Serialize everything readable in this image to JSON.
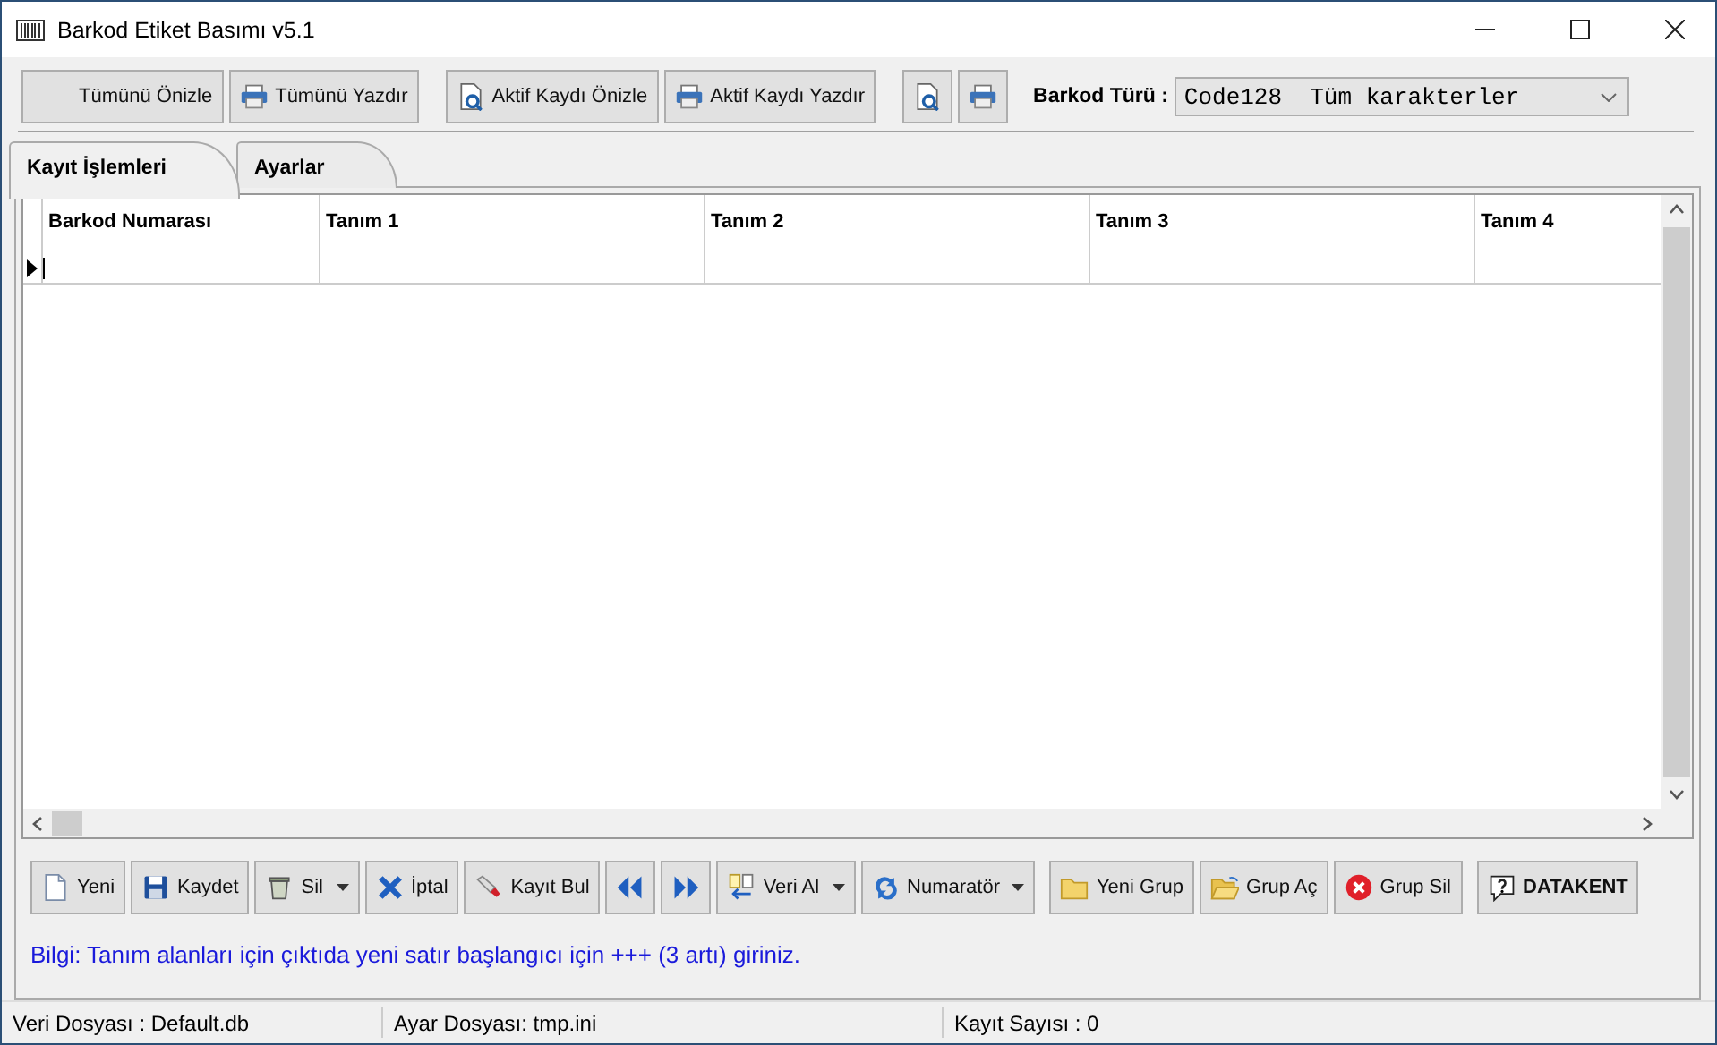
{
  "window": {
    "title": "Barkod Etiket Basımı  v5.1"
  },
  "toolbar": {
    "groups": [
      {
        "buttons": [
          {
            "label": "Tümünü Önizle",
            "kind": "none"
          },
          {
            "label": "Tümünü Yazdır",
            "kind": "print"
          }
        ]
      },
      {
        "buttons": [
          {
            "label": "Aktif Kaydı Önizle",
            "kind": "preview"
          },
          {
            "label": "Aktif Kaydı Yazdır",
            "kind": "print"
          }
        ]
      },
      {
        "buttons": [
          {
            "kind": "preview"
          },
          {
            "kind": "print"
          }
        ]
      }
    ],
    "barcode_type": {
      "label": "Barkod Türü :",
      "value": "Code128  Tüm karakterler"
    }
  },
  "tabs": [
    {
      "label": "Kayıt İşlemleri",
      "selected": true
    },
    {
      "label": "Ayarlar",
      "selected": false
    }
  ],
  "table": {
    "columns": [
      "Barkod Numarası",
      "Tanım 1",
      "Tanım 2",
      "Tanım 3",
      "Tanım 4"
    ]
  },
  "actions": {
    "groups": [
      {
        "buttons": [
          {
            "label": "Yeni",
            "kind": "page",
            "dropdown": false
          },
          {
            "label": "Kaydet",
            "kind": "save",
            "dropdown": false
          },
          {
            "label": "Sil",
            "kind": "trash",
            "dropdown": true
          },
          {
            "label": "İptal",
            "kind": "cross",
            "dropdown": false
          },
          {
            "label": "Kayıt Bul",
            "kind": "flashlight",
            "dropdown": false
          },
          {
            "kind": "prev",
            "dropdown": false
          },
          {
            "kind": "next",
            "dropdown": false
          },
          {
            "label": "Veri Al",
            "kind": "import",
            "dropdown": true
          },
          {
            "label": "Numaratör",
            "kind": "numerator",
            "dropdown": true
          }
        ]
      },
      {
        "buttons": [
          {
            "label": "Yeni Grup",
            "kind": "folder",
            "dropdown": false
          },
          {
            "label": "Grup Aç",
            "kind": "folder-open",
            "dropdown": false
          },
          {
            "label": "Grup Sil",
            "kind": "error",
            "dropdown": false
          }
        ]
      },
      {
        "buttons": [
          {
            "label": "DATAKENT",
            "kind": "help",
            "dropdown": false
          }
        ]
      }
    ]
  },
  "info": "Bilgi: Tanım alanları için çıktıda yeni satır başlangıcı için +++ (3 artı) giriniz.",
  "status_bar": [
    "Veri Dosyası : Default.db",
    "Ayar Dosyası: tmp.ini",
    "Kayıt Sayısı : 0"
  ]
}
